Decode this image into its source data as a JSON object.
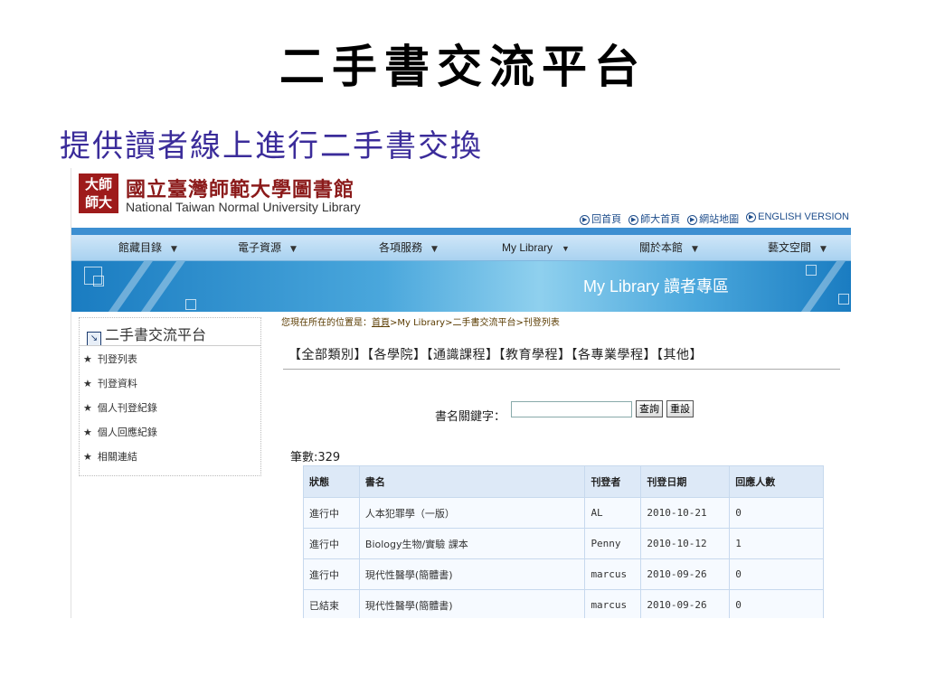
{
  "slide": {
    "title": "二手書交流平台",
    "subtitle": "提供讀者線上進行二手書交換"
  },
  "header": {
    "logo_mark_line1": "大師",
    "logo_mark_line2": "師大",
    "logo_zh": "國立臺灣師範大學圖書館",
    "logo_en": "National Taiwan Normal University Library",
    "top_links": [
      "回首頁",
      "師大首頁",
      "網站地圖",
      "ENGLISH VERSION"
    ]
  },
  "nav": {
    "items": [
      "館藏目錄",
      "電子資源",
      "各項服務",
      "My Library",
      "關於本館",
      "藝文空間"
    ]
  },
  "banner": {
    "title": "My Library 讀者專區"
  },
  "sidebar": {
    "heading": "二手書交流平台",
    "items": [
      "刊登列表",
      "刊登資料",
      "個人刊登紀錄",
      "個人回應紀錄",
      "相關連結"
    ]
  },
  "breadcrumb": {
    "prefix": "您現在所在的位置是：",
    "home": "首頁",
    "rest": ">My Library>二手書交流平台>刊登列表"
  },
  "categories": "【全部類別】【各學院】【通識課程】【教育學程】【各專業學程】【其他】",
  "search": {
    "label": "書名關鍵字：",
    "value": "",
    "query_button": "查詢",
    "reset_button": "重設"
  },
  "list": {
    "count_label": "筆數:329",
    "columns": [
      "狀態",
      "書名",
      "刊登者",
      "刊登日期",
      "回應人數"
    ],
    "rows": [
      [
        "進行中",
        "人本犯罪學（一版）",
        "AL",
        "2010-10-21",
        "0"
      ],
      [
        "進行中",
        "Biology生物/實驗 課本",
        "Penny",
        "2010-10-12",
        "1"
      ],
      [
        "進行中",
        "現代性醫學(簡體書)",
        "marcus",
        "2010-09-26",
        "0"
      ],
      [
        "已結束",
        "現代性醫學(簡體書)",
        "marcus",
        "2010-09-26",
        "0"
      ]
    ]
  }
}
